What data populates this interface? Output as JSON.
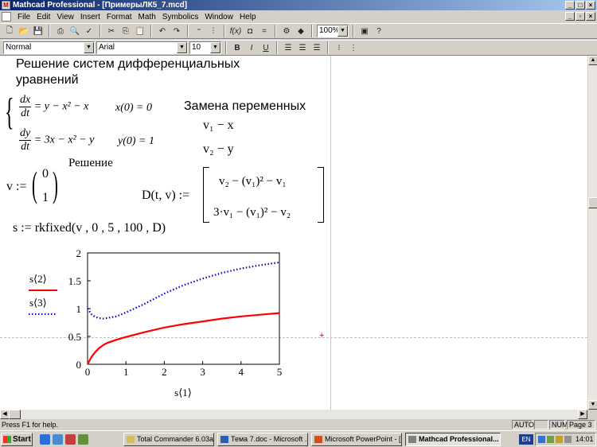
{
  "window": {
    "title": "Mathcad Professional - [ПримерыЛК5_7.mcd]",
    "app_icon": "mathcad-icon"
  },
  "menu": [
    "File",
    "Edit",
    "View",
    "Insert",
    "Format",
    "Math",
    "Symbolics",
    "Window",
    "Help"
  ],
  "toolbar": {
    "zoom": "100%",
    "style": "Normal",
    "font": "Arial",
    "size": "10"
  },
  "doc": {
    "heading_line1": "Решение систем дифференциальных",
    "heading_line2": "уравнений",
    "eq1_num": "dx",
    "eq1_den": "dt",
    "eq1_rhs": "= y − x² − x",
    "eq2_num": "dy",
    "eq2_den": "dt",
    "eq2_rhs": "= 3x − x² − y",
    "init1": "x(0) = 0",
    "init2": "y(0) = 1",
    "subst_label": "Замена переменных",
    "subst1": "v₁ − x",
    "subst2": "v₂ − y",
    "solution_label": "Решение",
    "v_def": "v :=",
    "v0": "0",
    "v1": "1",
    "D_def": "D(t, v) :=",
    "D_row1": "v₂ − (v₁)² − v₁",
    "D_row2": "3·v₁ − (v₁)² − v₂",
    "s_def": "s := rkfixed(v , 0 , 5 , 100 , D)"
  },
  "chart_data": {
    "type": "line",
    "x": [
      0,
      0.1,
      0.2,
      0.3,
      0.4,
      0.5,
      0.75,
      1,
      1.5,
      2,
      2.5,
      3,
      3.5,
      4,
      4.5,
      5
    ],
    "series": [
      {
        "name": "s⟨2⟩",
        "color": "#ff0000",
        "style": "solid",
        "values": [
          0,
          0.13,
          0.22,
          0.29,
          0.34,
          0.38,
          0.44,
          0.49,
          0.58,
          0.66,
          0.72,
          0.77,
          0.82,
          0.86,
          0.89,
          0.92
        ]
      },
      {
        "name": "s⟨3⟩",
        "color": "#0000cc",
        "style": "dotted",
        "values": [
          1,
          0.9,
          0.85,
          0.83,
          0.82,
          0.83,
          0.86,
          0.93,
          1.09,
          1.27,
          1.42,
          1.54,
          1.64,
          1.72,
          1.78,
          1.83
        ]
      }
    ],
    "xlabel": "s⟨1⟩",
    "xlim": [
      0,
      5
    ],
    "ylim": [
      0,
      2
    ],
    "xticks": [
      "0",
      "1",
      "2",
      "3",
      "4",
      "5"
    ],
    "yticks": [
      "0",
      "0.5",
      "1",
      "1.5",
      "2"
    ]
  },
  "status": {
    "help": "Press F1 for help.",
    "auto": "AUTO",
    "num": "NUM",
    "page": "Page 3"
  },
  "taskbar": {
    "start": "Start",
    "tasks": [
      "Total Commander 6.03a ...",
      "Тема 7.doc - Microsoft ...",
      "Microsoft PowerPoint - [...",
      "Mathcad Professional..."
    ],
    "lang": "EN",
    "clock": "14:01"
  }
}
